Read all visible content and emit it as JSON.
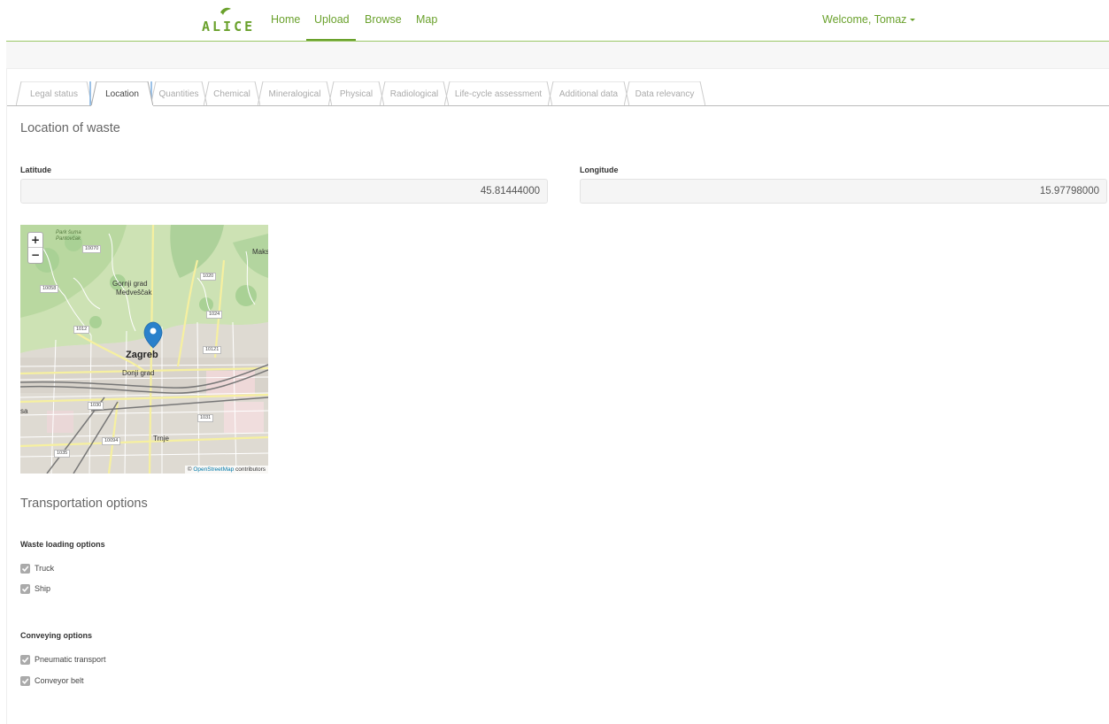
{
  "brand": {
    "name": "ALICE"
  },
  "nav": {
    "links": [
      {
        "label": "Home"
      },
      {
        "label": "Upload"
      },
      {
        "label": "Browse"
      },
      {
        "label": "Map"
      }
    ],
    "active": "Upload",
    "welcome": "Welcome, Tomaz"
  },
  "tabs": [
    {
      "label": "Legal status"
    },
    {
      "label": "Location"
    },
    {
      "label": "Quantities"
    },
    {
      "label": "Chemical"
    },
    {
      "label": "Mineralogical"
    },
    {
      "label": "Physical"
    },
    {
      "label": "Radiological"
    },
    {
      "label": "Life-cycle assessment"
    },
    {
      "label": "Additional data"
    },
    {
      "label": "Data relevancy"
    }
  ],
  "active_tab": "Location",
  "location": {
    "title": "Location of waste",
    "latitude_label": "Latitude",
    "latitude_value": "45.81444000",
    "longitude_label": "Longitude",
    "longitude_value": "15.97798000"
  },
  "map": {
    "zoom_in": "+",
    "zoom_out": "−",
    "attribution_prefix": "©",
    "attribution_link": "OpenStreetMap",
    "attribution_suffix": "contributors",
    "labels": {
      "zagreb": "Zagreb",
      "gornji_grad": "Gornji grad",
      "medvescak": "Medveščak",
      "donji_grad": "Donji grad",
      "trnje": "Trnje",
      "maksimir": "Maksim",
      "park_suma": "Park šuma",
      "pantovcak": "Pantovčak",
      "sa": "sa"
    },
    "road_numbers": [
      "10070",
      "1020",
      "10058",
      "1024",
      "1012",
      "10121",
      "1030",
      "1031",
      "10094",
      "1035"
    ]
  },
  "transport": {
    "title": "Transportation options",
    "loading_label": "Waste loading options",
    "loading": [
      {
        "label": "Truck",
        "checked": true
      },
      {
        "label": "Ship",
        "checked": true
      }
    ],
    "conveying_label": "Conveying options",
    "conveying": [
      {
        "label": "Pneumatic transport",
        "checked": true
      },
      {
        "label": "Conveyor belt",
        "checked": true
      }
    ]
  },
  "colors": {
    "brand_green": "#6aa12c",
    "nav_line": "#9bc766",
    "checkbox_gray": "#aaaaaa",
    "marker_blue": "#2a81cb"
  }
}
